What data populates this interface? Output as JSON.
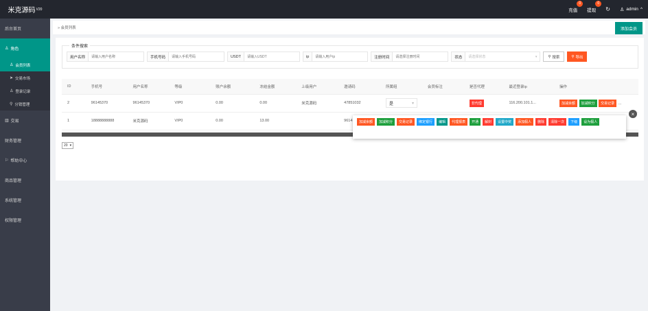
{
  "app": {
    "logo": "米克源码",
    "version": "V20"
  },
  "topbar": {
    "recharge": {
      "label": "充值",
      "badge": "0"
    },
    "withdraw": {
      "label": "提现",
      "badge": "0"
    },
    "user": "admin"
  },
  "sidebar": {
    "items": [
      {
        "label": "后台首页"
      },
      {
        "label": "角色",
        "icon": "user-icon"
      },
      {
        "label": "会员列表"
      },
      {
        "label": "交易市场",
        "icon": "send-icon"
      },
      {
        "label": "登录记录",
        "icon": "users-icon"
      },
      {
        "label": "分销管理",
        "icon": "share-icon"
      },
      {
        "label": "交易",
        "icon": "chart-icon"
      },
      {
        "label": "财务管理"
      },
      {
        "label": "帮助中心",
        "icon": "help-icon"
      },
      {
        "label": "商品管理"
      },
      {
        "label": "系统管理"
      },
      {
        "label": "权限管理"
      }
    ]
  },
  "breadcrumb": "» 会员列表",
  "add_button": "添加会员",
  "filter": {
    "legend": "条件搜索",
    "fields": [
      {
        "label": "用户名称",
        "placeholder": "请输入用户名称"
      },
      {
        "label": "手机号码",
        "placeholder": "请输入手机号码"
      },
      {
        "label": "USDT",
        "placeholder": "请输入USDT"
      },
      {
        "label": "ip",
        "placeholder": "请输入用户ip"
      },
      {
        "label": "注册时间",
        "placeholder": "请选择注册时间"
      }
    ],
    "status": {
      "label": "状态",
      "placeholder": "请选择状态"
    },
    "search_label": "搜索",
    "export_label": "导出"
  },
  "table": {
    "headers": [
      "ID",
      "手机号",
      "用户名称",
      "等级",
      "账户余额",
      "冻结金额",
      "上级用户",
      "邀请码",
      "所属组",
      "会员标注",
      "是否代理",
      "最近登录ip",
      "操作"
    ],
    "rows": [
      {
        "id": "2",
        "phone": "96145370",
        "name": "96145370",
        "level": "VIP0",
        "balance": "0.00",
        "frozen": "0.00",
        "parent": "米克源码",
        "invite": "47851032",
        "group": "是",
        "note": "",
        "agent": "非代理",
        "ip": "116.200.101.1...",
        "ops": [
          "加减余额",
          "加减积分",
          "交易记录"
        ]
      },
      {
        "id": "1",
        "phone": "18888888888",
        "name": "米克源码",
        "level": "VIP0",
        "balance": "0.00",
        "frozen": "13.00",
        "parent": "",
        "invite": "9614",
        "group": "",
        "note": "",
        "agent": "",
        "ip": "",
        "ops": []
      }
    ]
  },
  "popup_actions": [
    {
      "label": "加减余额",
      "color": "#ff5722"
    },
    {
      "label": "加减积分",
      "color": "#1e9f3d"
    },
    {
      "label": "交易记录",
      "color": "#ff5722"
    },
    {
      "label": "绑定银行",
      "color": "#1e9fff"
    },
    {
      "label": "编辑",
      "color": "#009688"
    },
    {
      "label": "代理报表",
      "color": "#ff5722"
    },
    {
      "label": "开通",
      "color": "#1e9f3d"
    },
    {
      "label": "解封",
      "color": "#ff3b30"
    },
    {
      "label": "设置中奖",
      "color": "#20a8c8"
    },
    {
      "label": "添加假人",
      "color": "#ff5722"
    },
    {
      "label": "删除",
      "color": "#ff3b30"
    },
    {
      "label": "清除一次",
      "color": "#ff3b30"
    },
    {
      "label": "下级",
      "color": "#1e9fff"
    },
    {
      "label": "设为假人",
      "color": "#1e9f3d"
    }
  ],
  "pagination": {
    "page_size": "20"
  }
}
